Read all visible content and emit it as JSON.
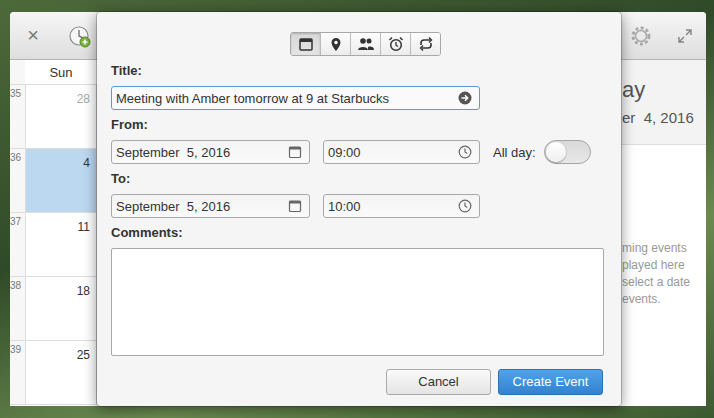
{
  "window": {
    "close": "×"
  },
  "calendar": {
    "weekday": "Sun",
    "weeks": [
      {
        "number": "35",
        "day": "28",
        "other_month": true,
        "selected": false
      },
      {
        "number": "36",
        "day": "4",
        "other_month": false,
        "selected": true
      },
      {
        "number": "37",
        "day": "11",
        "other_month": false,
        "selected": false
      },
      {
        "number": "38",
        "day": "18",
        "other_month": false,
        "selected": false
      },
      {
        "number": "39",
        "day": "25",
        "other_month": false,
        "selected": false
      }
    ]
  },
  "sidebar": {
    "title": "ay",
    "date": "er  4, 2016",
    "message": [
      "ming events",
      "played here",
      "select a date",
      "events."
    ]
  },
  "dialog": {
    "tabs": [
      {
        "kind": "details",
        "selected": true
      },
      {
        "kind": "location",
        "selected": false
      },
      {
        "kind": "guests",
        "selected": false
      },
      {
        "kind": "reminders",
        "selected": false
      },
      {
        "kind": "repeat",
        "selected": false
      }
    ],
    "title": {
      "label": "Title:",
      "value": "Meeting with Amber tomorrow at 9 at Starbucks"
    },
    "from": {
      "label": "From:",
      "date": "September  5, 2016",
      "time": "09:00"
    },
    "all_day": {
      "label": "All day:",
      "on": false
    },
    "to": {
      "label": "To:",
      "date": "September  5, 2016",
      "time": "10:00"
    },
    "comments": {
      "label": "Comments:",
      "value": ""
    },
    "buttons": [
      {
        "label": "Cancel",
        "kind": "secondary"
      },
      {
        "label": "Create Event",
        "kind": "primary"
      }
    ]
  }
}
